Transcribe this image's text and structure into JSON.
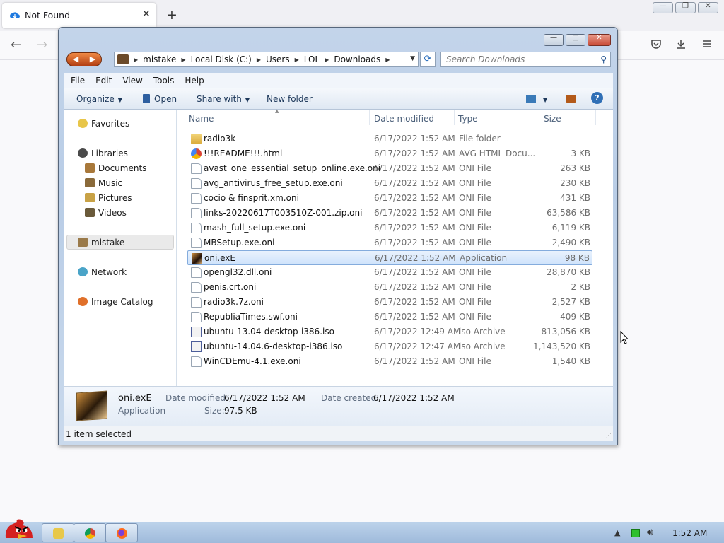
{
  "browser": {
    "tab_title": "Not Found",
    "tab_close": "✕",
    "new_tab": "+",
    "back": "←",
    "forward": "→",
    "window_min": "—",
    "window_restore": "❐",
    "window_close": "✕"
  },
  "explorer": {
    "controls": {
      "minimize": "—",
      "maximize": "□",
      "close": "✕"
    },
    "back": "◀",
    "forward": "▶",
    "breadcrumbs": [
      "mistake",
      "Local Disk (C:)",
      "Users",
      "LOL",
      "Downloads"
    ],
    "crumb_separator": "▶",
    "search_placeholder": "Search Downloads",
    "menu": [
      "File",
      "Edit",
      "View",
      "Tools",
      "Help"
    ],
    "toolbar": {
      "organize": "Organize",
      "open": "Open",
      "share_with": "Share with",
      "new_folder": "New folder",
      "help": "?"
    },
    "nav": {
      "favorites": "Favorites",
      "libraries": "Libraries",
      "documents": "Documents",
      "music": "Music",
      "pictures": "Pictures",
      "videos": "Videos",
      "homegroup": "mistake",
      "network": "Network",
      "image_catalog": "Image Catalog"
    },
    "columns": {
      "name": "Name",
      "date": "Date modified",
      "type": "Type",
      "size": "Size"
    },
    "files": [
      {
        "name": "radio3k",
        "date": "6/17/2022 1:52 AM",
        "type": "File folder",
        "size": "",
        "icon": "folder-icon"
      },
      {
        "name": "!!!README!!!.html",
        "date": "6/17/2022 1:52 AM",
        "type": "AVG HTML Docu...",
        "size": "3 KB",
        "icon": "html-icon"
      },
      {
        "name": "avast_one_essential_setup_online.exe.oni",
        "date": "6/17/2022 1:52 AM",
        "type": "ONI File",
        "size": "263 KB",
        "icon": "file-icon"
      },
      {
        "name": "avg_antivirus_free_setup.exe.oni",
        "date": "6/17/2022 1:52 AM",
        "type": "ONI File",
        "size": "230 KB",
        "icon": "file-icon"
      },
      {
        "name": "cocio & finsprit.xm.oni",
        "date": "6/17/2022 1:52 AM",
        "type": "ONI File",
        "size": "431 KB",
        "icon": "file-icon"
      },
      {
        "name": "links-20220617T003510Z-001.zip.oni",
        "date": "6/17/2022 1:52 AM",
        "type": "ONI File",
        "size": "63,586 KB",
        "icon": "file-icon"
      },
      {
        "name": "mash_full_setup.exe.oni",
        "date": "6/17/2022 1:52 AM",
        "type": "ONI File",
        "size": "6,119 KB",
        "icon": "file-icon"
      },
      {
        "name": "MBSetup.exe.oni",
        "date": "6/17/2022 1:52 AM",
        "type": "ONI File",
        "size": "2,490 KB",
        "icon": "file-icon"
      },
      {
        "name": "oni.exE",
        "date": "6/17/2022 1:52 AM",
        "type": "Application",
        "size": "98 KB",
        "icon": "app-icon",
        "selected": true
      },
      {
        "name": "opengl32.dll.oni",
        "date": "6/17/2022 1:52 AM",
        "type": "ONI File",
        "size": "28,870 KB",
        "icon": "file-icon"
      },
      {
        "name": "penis.crt.oni",
        "date": "6/17/2022 1:52 AM",
        "type": "ONI File",
        "size": "2 KB",
        "icon": "file-icon"
      },
      {
        "name": "radio3k.7z.oni",
        "date": "6/17/2022 1:52 AM",
        "type": "ONI File",
        "size": "2,527 KB",
        "icon": "file-icon"
      },
      {
        "name": "RepubliaTimes.swf.oni",
        "date": "6/17/2022 1:52 AM",
        "type": "ONI File",
        "size": "409 KB",
        "icon": "file-icon"
      },
      {
        "name": "ubuntu-13.04-desktop-i386.iso",
        "date": "6/17/2022 12:49 AM",
        "type": "iso Archive",
        "size": "813,056 KB",
        "icon": "iso-icon"
      },
      {
        "name": "ubuntu-14.04.6-desktop-i386.iso",
        "date": "6/17/2022 12:47 AM",
        "type": "iso Archive",
        "size": "1,143,520 KB",
        "icon": "iso-icon"
      },
      {
        "name": "WinCDEmu-4.1.exe.oni",
        "date": "6/17/2022 1:52 AM",
        "type": "ONI File",
        "size": "1,540 KB",
        "icon": "file-icon"
      }
    ],
    "details": {
      "name": "oni.exE",
      "type": "Application",
      "modified_label": "Date modified:",
      "modified_value": "6/17/2022 1:52 AM",
      "created_label": "Date created:",
      "created_value": "6/17/2022 1:52 AM",
      "size_label": "Size:",
      "size_value": "97.5 KB"
    },
    "status": "1 item selected"
  },
  "taskbar": {
    "clock": "1:52 AM"
  },
  "colors": {
    "selection": "#cfe3fb",
    "window_frame": "#c3d4ea",
    "taskbar": "#bcd2ea"
  }
}
